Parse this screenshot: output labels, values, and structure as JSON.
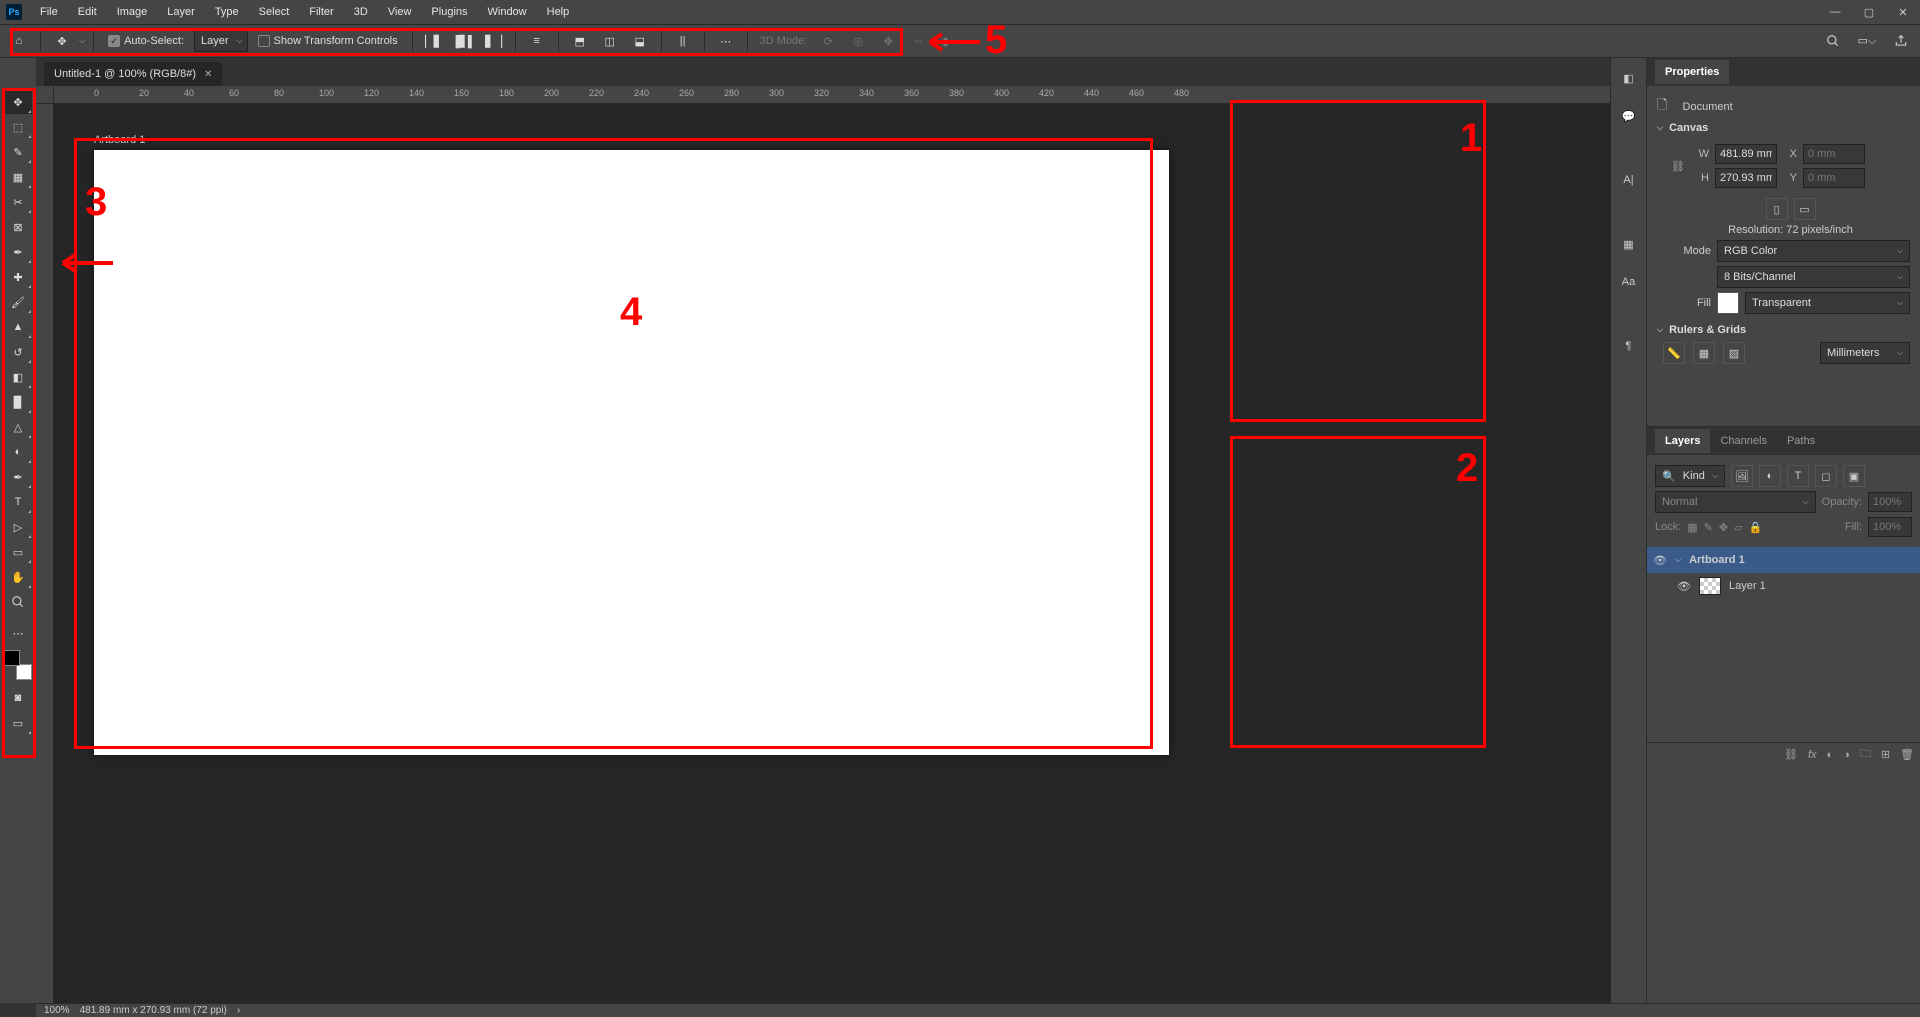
{
  "menubar": {
    "logo": "Ps",
    "items": [
      "File",
      "Edit",
      "Image",
      "Layer",
      "Type",
      "Select",
      "Filter",
      "3D",
      "View",
      "Plugins",
      "Window",
      "Help"
    ]
  },
  "options": {
    "auto_select_label": "Auto-Select:",
    "auto_select_value": "Layer",
    "show_transform": "Show Transform Controls",
    "threeD_label": "3D Mode:"
  },
  "doc_tab": {
    "title": "Untitled-1 @ 100% (RGB/8#)"
  },
  "ruler_ticks_h": [
    0,
    20,
    40,
    60,
    80,
    100,
    120,
    140,
    160,
    180,
    200,
    220,
    240,
    260,
    280,
    300,
    320,
    340,
    360,
    380,
    400,
    420,
    440,
    460,
    480
  ],
  "artboard_label": "Artboard 1",
  "properties": {
    "tab": "Properties",
    "doc_label": "Document",
    "canvas_label": "Canvas",
    "W_label": "W",
    "W_val": "481.89 mm",
    "H_label": "H",
    "H_val": "270.93 mm",
    "X_label": "X",
    "X_val": "0 mm",
    "Y_label": "Y",
    "Y_val": "0 mm",
    "resolution": "Resolution: 72 pixels/inch",
    "mode_label": "Mode",
    "mode_val": "RGB Color",
    "depth_val": "8 Bits/Channel",
    "fill_label": "Fill",
    "fill_val": "Transparent",
    "rulers_label": "Rulers & Grids",
    "units_val": "Millimeters"
  },
  "layers": {
    "tabs": [
      "Layers",
      "Channels",
      "Paths"
    ],
    "filter_label": "Kind",
    "blend": "Normal",
    "opacity_label": "Opacity:",
    "opacity_val": "100%",
    "lock_label": "Lock:",
    "fill_label": "Fill:",
    "fill_val": "100%",
    "rows": [
      {
        "name": "Artboard 1",
        "group": true
      },
      {
        "name": "Layer 1",
        "group": false
      }
    ]
  },
  "status": {
    "zoom": "100%",
    "info": "481.89 mm x 270.93 mm (72 ppi)"
  },
  "annotations": {
    "n1": "1",
    "n2": "2",
    "n3": "3",
    "n4": "4",
    "n5": "5"
  }
}
